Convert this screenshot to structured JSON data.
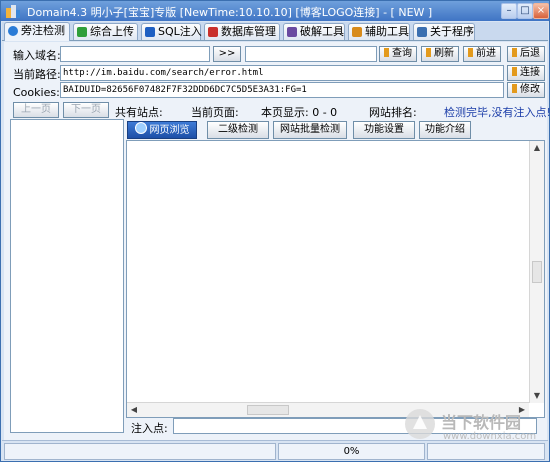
{
  "window": {
    "title": "Domain4.3 明小子[宝宝]专版 [NewTime:10.10.10] [博客LOGO连接]  - [ NEW ]"
  },
  "window_controls": {
    "minimize": "–",
    "maximize": "□",
    "close": "×"
  },
  "tabs": [
    {
      "label": "旁注检测",
      "active": true,
      "icon_color": "#2a7bd6"
    },
    {
      "label": "综合上传",
      "active": false,
      "icon_color": "#2f9e3a"
    },
    {
      "label": "SQL注入",
      "active": false,
      "icon_color": "#1e5fc2"
    },
    {
      "label": "数据库管理",
      "active": false,
      "icon_color": "#c9302c"
    },
    {
      "label": "破解工具",
      "active": false,
      "icon_color": "#6a4aa0"
    },
    {
      "label": "辅助工具",
      "active": false,
      "icon_color": "#d88b1b"
    },
    {
      "label": "关于程序",
      "active": false,
      "icon_color": "#3b6fb0"
    }
  ],
  "form": {
    "domain_label": "输入域名:",
    "domain_value": "",
    "go_button": ">>",
    "extra_value": "",
    "path_label": "当前路径:",
    "path_value": "http://im.baidu.com/search/error.html",
    "cookies_label": "Cookies:",
    "cookies_value": "BAIDUID=82656F07482F7F32DDD6DC7C5D5E3A31:FG=1"
  },
  "right_buttons": {
    "query": "查询",
    "refresh": "刷新",
    "forward": "前进",
    "back": "后退",
    "connect": "连接",
    "modify": "修改"
  },
  "pager": {
    "prev": "上一页",
    "next": "下一页"
  },
  "stats": {
    "total_sites": "共有站点:",
    "current_page": "当前页面:",
    "page_display": "本页显示: 0 - 0",
    "site_rank": "网站排名:",
    "status": "检测完毕,没有注入点!"
  },
  "toolbar": {
    "browse": "网页浏览",
    "secondary_check": "二级检测",
    "batch_check": "网站批量检测",
    "settings": "功能设置",
    "intro": "功能介绍"
  },
  "scroll": {
    "up": "▲",
    "down": "▼",
    "left": "◀",
    "right": "▶"
  },
  "injection": {
    "label": "注入点:",
    "value": ""
  },
  "statusbar": {
    "progress": "0%"
  },
  "watermark": {
    "title": "当下软件园",
    "url": "www.downxia.com"
  },
  "colors": {
    "title_bar": "#3f74c4",
    "status_text": "#1a3ca8",
    "accent_orange": "#e39a1c"
  }
}
